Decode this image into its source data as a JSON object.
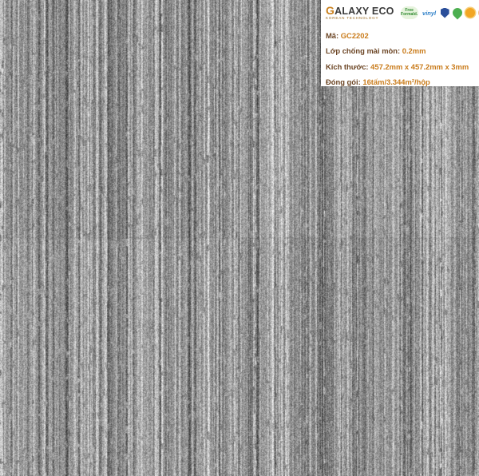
{
  "brand": {
    "logo_text_first": "G",
    "logo_text_rest": "ALAXY ECO",
    "logo_tagline": "KOREAN TECHNOLOGY"
  },
  "certifications": [
    {
      "icon": "free-badge-icon",
      "text_top": "Free",
      "text_bottom": "Formald."
    },
    {
      "icon": "vinyl-badge-icon",
      "text": "vinyl"
    },
    {
      "icon": "shield-badge-icon"
    },
    {
      "icon": "leaf-badge-icon"
    },
    {
      "icon": "sun-badge-icon"
    },
    {
      "icon": "quality-badge-icon"
    }
  ],
  "specs": {
    "code_label": "Mã:",
    "code_value": "GC2202",
    "wear_label": "Lớp chống mài mòn:",
    "wear_value": "0.2mm",
    "size_label": "Kích thước:",
    "size_value": "457.2mm x 457.2mm x 3mm",
    "pack_label": "Đóng gói:",
    "pack_value": "16tấm/3.344m²/hộp"
  },
  "colors": {
    "label": "#6b4423",
    "value": "#c97b1a",
    "texture_base": "#8e8e8e",
    "texture_light": "#e4e4e4",
    "texture_dark": "#4d4d4d"
  }
}
